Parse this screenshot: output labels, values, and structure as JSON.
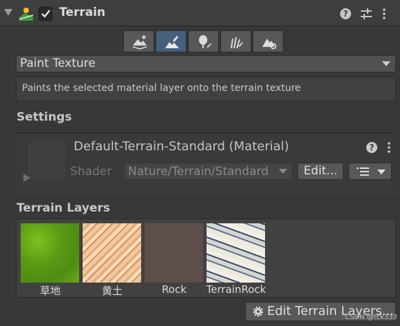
{
  "component": {
    "title": "Terrain",
    "enabled": true,
    "icons": [
      "terrain-component-icon",
      "help-icon",
      "preset-icon",
      "context-menu-icon"
    ]
  },
  "toolbar": {
    "tools": [
      {
        "name": "create-neighbor-terrains",
        "icon": "terrain-add-icon",
        "selected": false
      },
      {
        "name": "paint-terrain",
        "icon": "paint-brush-icon",
        "selected": true
      },
      {
        "name": "paint-trees",
        "icon": "tree-icon",
        "selected": false
      },
      {
        "name": "paint-details",
        "icon": "grass-icon",
        "selected": false
      },
      {
        "name": "terrain-settings",
        "icon": "terrain-settings-icon",
        "selected": false
      }
    ]
  },
  "mode": {
    "selected": "Paint Texture",
    "description": "Paints the selected material layer onto the terrain texture"
  },
  "settings": {
    "heading": "Settings",
    "material_name": "Default-Terrain-Standard (Material)",
    "shader_label": "Shader",
    "shader_value": "Nature/Terrain/Standard",
    "edit_label": "Edit..."
  },
  "layers": {
    "heading": "Terrain Layers",
    "items": [
      {
        "name": "草地",
        "texture": "grass"
      },
      {
        "name": "黄土",
        "texture": "soil"
      },
      {
        "name": "Rock",
        "texture": "rock"
      },
      {
        "name": "TerrainRock",
        "texture": "terrain-rock"
      }
    ],
    "edit_button_label": "Edit Terrain Layers..."
  },
  "watermark": "CSDN @tck333",
  "colors": {
    "background": "#383838",
    "selected_tool": "#46607c",
    "button": "#585858"
  }
}
